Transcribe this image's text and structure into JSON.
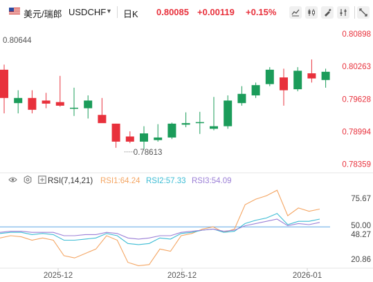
{
  "header": {
    "pair_name": "美元/瑞郎",
    "symbol": "USDCHF",
    "timeframe": "日K",
    "price": "0.80085",
    "change": "+0.00119",
    "change_pct": "+0.15%"
  },
  "icons": [
    "us-flag-icon",
    "dropdown-caret-icon",
    "line-chart-icon",
    "candlestick-icon",
    "draw-icon",
    "indicators-icon",
    "fullscreen-icon",
    "eye-icon",
    "settings-icon",
    "maximize-icon"
  ],
  "colors": {
    "up": "#1b9c5a",
    "down": "#e8313c",
    "rsi1": "#f4a562",
    "rsi2": "#3bbcd4",
    "rsi3": "#9b7fd6",
    "ref_line": "#5aa6e6"
  },
  "chart_data": [
    {
      "type": "candlestick",
      "title": "USDCHF",
      "y_ticks": [
        "0.80898",
        "0.80263",
        "0.79628",
        "0.78994",
        "0.78359"
      ],
      "ylim": [
        0.7822,
        0.811
      ],
      "annotations": {
        "high_label": "0.80644",
        "low_label": "0.78613"
      },
      "candles": [
        {
          "o": 0.802,
          "h": 0.803,
          "l": 0.7935,
          "c": 0.7965
        },
        {
          "o": 0.7955,
          "h": 0.798,
          "l": 0.7935,
          "c": 0.7965
        },
        {
          "o": 0.7965,
          "h": 0.798,
          "l": 0.7935,
          "c": 0.7942
        },
        {
          "o": 0.796,
          "h": 0.7975,
          "l": 0.7945,
          "c": 0.7954
        },
        {
          "o": 0.7957,
          "h": 0.8008,
          "l": 0.7948,
          "c": 0.795
        },
        {
          "o": 0.7945,
          "h": 0.7985,
          "l": 0.793,
          "c": 0.7946
        },
        {
          "o": 0.7945,
          "h": 0.797,
          "l": 0.7925,
          "c": 0.796
        },
        {
          "o": 0.7932,
          "h": 0.7965,
          "l": 0.792,
          "c": 0.7916
        },
        {
          "o": 0.7915,
          "h": 0.7915,
          "l": 0.7868,
          "c": 0.788
        },
        {
          "o": 0.789,
          "h": 0.79,
          "l": 0.7877,
          "c": 0.788
        },
        {
          "o": 0.788,
          "h": 0.791,
          "l": 0.7865,
          "c": 0.7896
        },
        {
          "o": 0.7883,
          "h": 0.7914,
          "l": 0.788,
          "c": 0.7888
        },
        {
          "o": 0.7888,
          "h": 0.7917,
          "l": 0.7885,
          "c": 0.7915
        },
        {
          "o": 0.7913,
          "h": 0.7937,
          "l": 0.7908,
          "c": 0.7916
        },
        {
          "o": 0.7918,
          "h": 0.7938,
          "l": 0.7895,
          "c": 0.7918
        },
        {
          "o": 0.7905,
          "h": 0.7967,
          "l": 0.7902,
          "c": 0.791
        },
        {
          "o": 0.791,
          "h": 0.797,
          "l": 0.7905,
          "c": 0.796
        },
        {
          "o": 0.7955,
          "h": 0.7988,
          "l": 0.795,
          "c": 0.7973
        },
        {
          "o": 0.797,
          "h": 0.7995,
          "l": 0.7965,
          "c": 0.799
        },
        {
          "o": 0.7992,
          "h": 0.8025,
          "l": 0.7988,
          "c": 0.802
        },
        {
          "o": 0.8005,
          "h": 0.8022,
          "l": 0.795,
          "c": 0.798
        },
        {
          "o": 0.7982,
          "h": 0.8025,
          "l": 0.7978,
          "c": 0.8018
        },
        {
          "o": 0.8013,
          "h": 0.804,
          "l": 0.7995,
          "c": 0.8003
        },
        {
          "o": 0.8,
          "h": 0.8022,
          "l": 0.7985,
          "c": 0.8016
        }
      ]
    },
    {
      "type": "line",
      "title": "RSI(7,14,21)",
      "y_ticks": [
        "75.67",
        "50.00",
        "48.27",
        "20.86"
      ],
      "x_ticks": [
        "2025-12",
        "2025-12",
        "2026-01"
      ],
      "ylim": [
        14.0,
        85.0
      ],
      "reference_line": 50,
      "series": [
        {
          "name": "RSI1",
          "label": "RSI1:64.24",
          "values": [
            40,
            42,
            41,
            38,
            40,
            38,
            24,
            22,
            26,
            30,
            42,
            38,
            18,
            15,
            16,
            30,
            28,
            42,
            44,
            48,
            50,
            45,
            48,
            70,
            75,
            78,
            83,
            60,
            67,
            64,
            66
          ]
        },
        {
          "name": "RSI2",
          "label": "RSI2:57.33",
          "values": [
            44,
            45,
            45,
            43,
            44,
            43,
            38,
            38,
            39,
            40,
            44,
            42,
            35,
            34,
            35,
            40,
            39,
            44,
            45,
            47,
            48,
            45,
            46,
            53,
            56,
            58,
            62,
            52,
            55,
            55,
            57
          ]
        },
        {
          "name": "RSI3",
          "label": "RSI3:54.09",
          "values": [
            45,
            46,
            46,
            45,
            45,
            45,
            42,
            42,
            43,
            43,
            45,
            44,
            40,
            39,
            40,
            42,
            42,
            45,
            46,
            47,
            48,
            46,
            47,
            51,
            53,
            55,
            57,
            51,
            53,
            52,
            54
          ]
        }
      ]
    }
  ]
}
